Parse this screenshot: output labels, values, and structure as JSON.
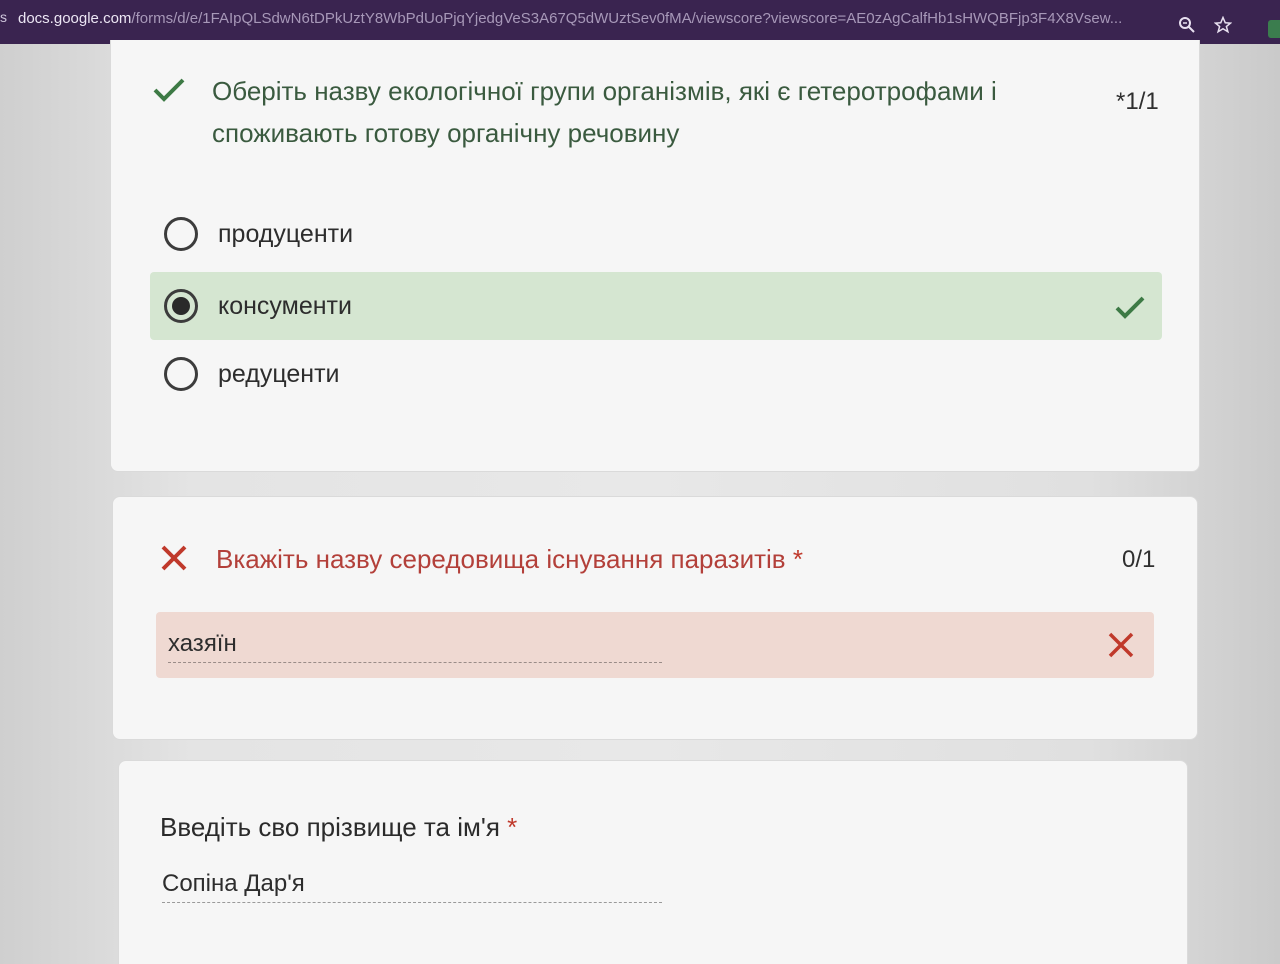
{
  "browser": {
    "url_host": "docs.google.com",
    "url_path": "/forms/d/e/1FAIpQLSdwN6tDPkUztY8WbPdUoPjqYjedgVeS3A67Q5dWUztSev0fMA/viewscore?viewscore=AE0zAgCalfHb1sHWQBFjp3F4X8Vsew...",
    "icons": [
      "zoom-icon",
      "star-icon"
    ]
  },
  "questions": [
    {
      "title": "Оберіть назву екологічної групи організмів, які є гетеротрофами і споживають готову органічну речовину",
      "score": "*1/1",
      "status": "correct",
      "options": [
        {
          "label": "продуценти",
          "selected": false
        },
        {
          "label": "консументи",
          "selected": true,
          "correct": true
        },
        {
          "label": "редуценти",
          "selected": false
        }
      ]
    },
    {
      "title": "Вкажіть назву середовища існування паразитів",
      "required_mark": "*",
      "score": "0/1",
      "status": "incorrect",
      "answer": "хазяїн"
    },
    {
      "title": "Введіть сво прізвище та ім'я",
      "required_mark": "*",
      "answer": "Сопіна Дар'я"
    }
  ],
  "colors": {
    "correct_green": "#3d7a45",
    "correct_bg": "#d5e6d1",
    "incorrect_red": "#c0392b",
    "incorrect_bg": "#efd9d2"
  }
}
